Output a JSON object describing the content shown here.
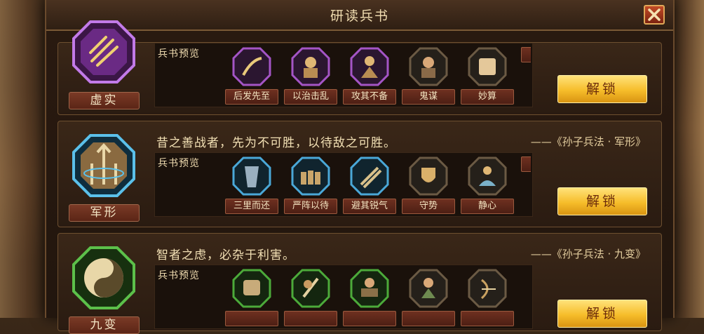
{
  "window": {
    "title": "研读兵书",
    "close_icon": "close-icon"
  },
  "rows": [
    {
      "book_name": "虚实",
      "emblem_icon": "purple-claw-emblem-icon",
      "preview_label": "兵书预览",
      "skills": [
        "后发先至",
        "以治击乱",
        "攻其不备",
        "鬼谋",
        "妙算"
      ],
      "unlock_label": "解锁"
    },
    {
      "book_name": "军形",
      "emblem_icon": "blue-spear-emblem-icon",
      "quote": "昔之善战者，先为不可胜，以待敌之可胜。",
      "source": "——《孙子兵法 · 军形》",
      "preview_label": "兵书预览",
      "skills": [
        "三里而还",
        "严阵以待",
        "避其锐气",
        "守势",
        "静心"
      ],
      "unlock_label": "解锁"
    },
    {
      "book_name": "九变",
      "emblem_icon": "green-yinyang-emblem-icon",
      "quote": "智者之虑，必杂于利害。",
      "source": "——《孙子兵法 · 九变》",
      "preview_label": "兵书预览",
      "skills": [
        "",
        "",
        "",
        "",
        ""
      ],
      "unlock_label": "解锁"
    }
  ],
  "colors": {
    "purple": "#9a4ac8",
    "blue": "#4aa8d8",
    "green": "#4caa3a",
    "gold": "#f6bd2a"
  }
}
